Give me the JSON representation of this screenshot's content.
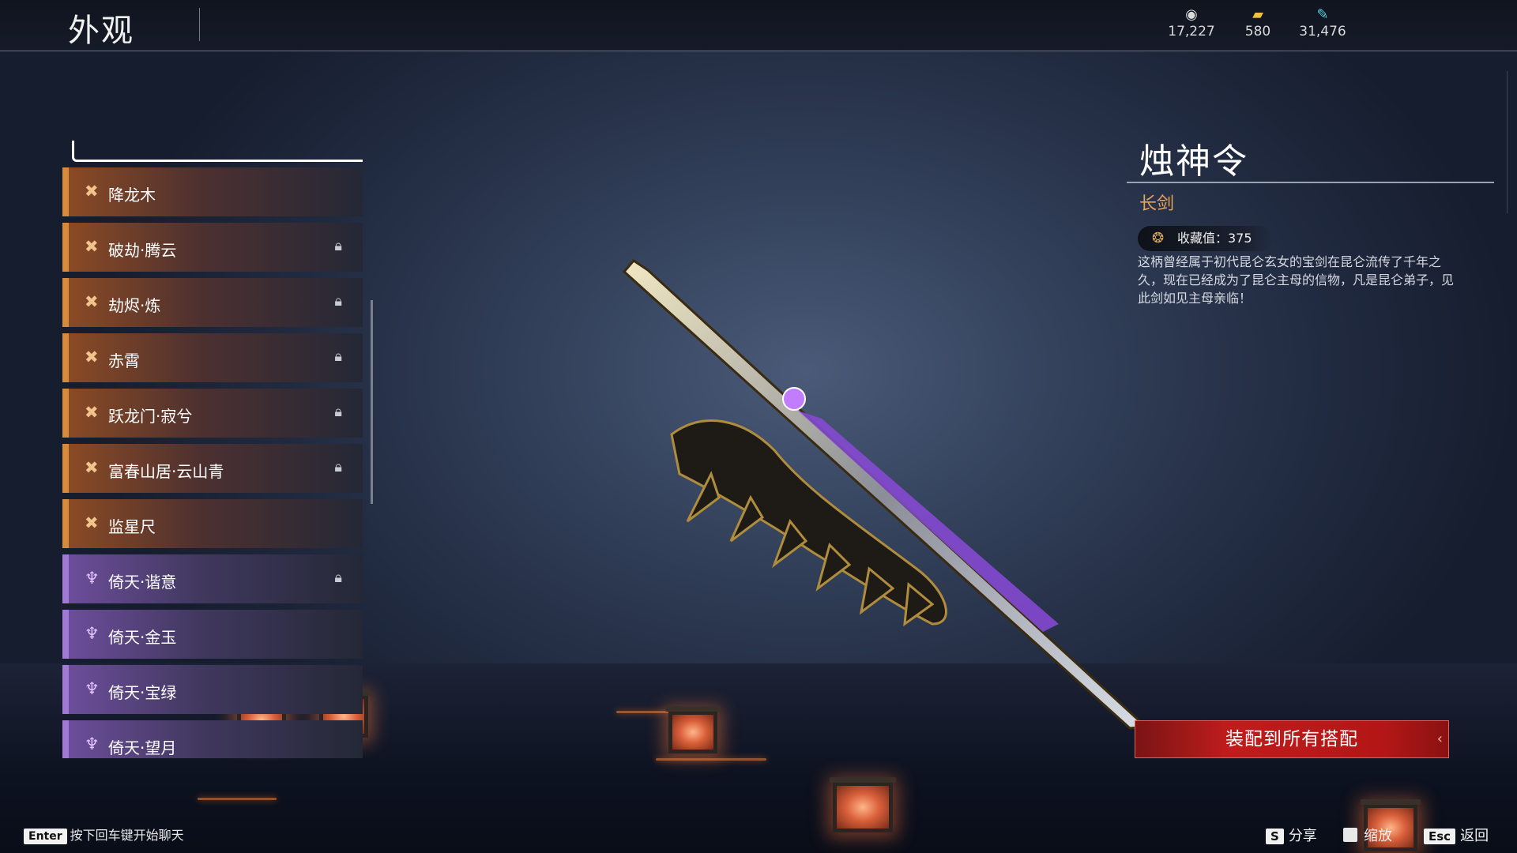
{
  "header": {
    "title": "外观",
    "currencies": [
      {
        "icon": "coin-icon",
        "value": "17,227"
      },
      {
        "icon": "gold-ingot-icon",
        "value": "580"
      },
      {
        "icon": "feather-icon",
        "value": "31,476"
      }
    ]
  },
  "list": {
    "items": [
      {
        "label": "降龙木",
        "rarity": "orange",
        "locked": false
      },
      {
        "label": "破劫·腾云",
        "rarity": "orange",
        "locked": true
      },
      {
        "label": "劫烬·炼",
        "rarity": "orange",
        "locked": true
      },
      {
        "label": "赤霄",
        "rarity": "orange",
        "locked": true
      },
      {
        "label": "跃龙门·寂兮",
        "rarity": "orange",
        "locked": true
      },
      {
        "label": "富春山居·云山青",
        "rarity": "orange",
        "locked": true
      },
      {
        "label": "监星尺",
        "rarity": "orange",
        "locked": false
      },
      {
        "label": "倚天·谐意",
        "rarity": "purple",
        "locked": true
      },
      {
        "label": "倚天·金玉",
        "rarity": "purple",
        "locked": false
      },
      {
        "label": "倚天·宝绿",
        "rarity": "purple",
        "locked": false
      },
      {
        "label": "倚天·望月",
        "rarity": "purple",
        "locked": false
      }
    ]
  },
  "detail": {
    "name": "烛神令",
    "type": "长剑",
    "collection_label": "收藏值：375",
    "description": "这柄曾经属于初代昆仑玄女的宝剑在昆仑流传了千年之久，现在已经成为了昆仑主母的信物，凡是昆仑弟子，见此剑如见主母亲临！",
    "equip_button": "装配到所有搭配"
  },
  "footer": {
    "chat_key": "Enter",
    "chat_hint": "按下回车键开始聊天",
    "share_key": "S",
    "share_label": "分享",
    "zoom_label": "缩放",
    "back_key": "Esc",
    "back_label": "返回"
  },
  "colors": {
    "accent_orange": "#d68a3a",
    "accent_purple": "#a17ad8",
    "equip_red": "#c01c1c",
    "type_gold": "#e8a556"
  }
}
